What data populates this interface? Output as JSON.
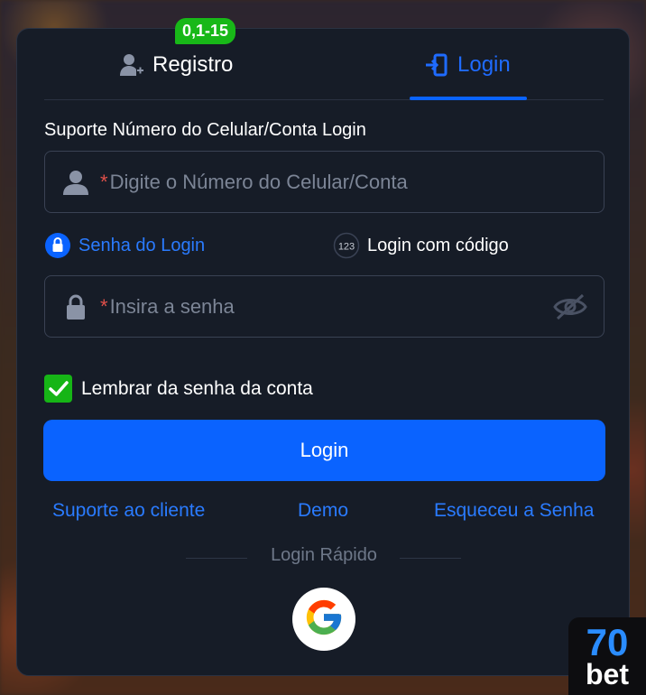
{
  "tabs": {
    "register_label": "Registro",
    "register_badge": "0,1-15",
    "login_label": "Login"
  },
  "form": {
    "section_label": "Suporte Número do Celular/Conta Login",
    "account": {
      "required_mark": "*",
      "placeholder": "Digite o Número do Celular/Conta"
    },
    "password": {
      "required_mark": "*",
      "placeholder": "Insira a senha"
    },
    "login_options": {
      "password_login": "Senha do Login",
      "code_login": "Login com código",
      "code_icon_text": "123"
    },
    "remember": {
      "label": "Lembrar da senha da conta",
      "checked": true
    },
    "submit_label": "Login"
  },
  "links": {
    "support": "Suporte ao cliente",
    "demo": "Demo",
    "forgot": "Esqueceu a Senha"
  },
  "quick_login": {
    "label": "Login Rápido",
    "providers": [
      "google-icon"
    ]
  },
  "brand": {
    "top": "70",
    "bottom": "bet"
  },
  "colors": {
    "accent": "#0a63ff",
    "badge": "#18b818",
    "panel": "#161c27",
    "required": "#e0504a"
  }
}
